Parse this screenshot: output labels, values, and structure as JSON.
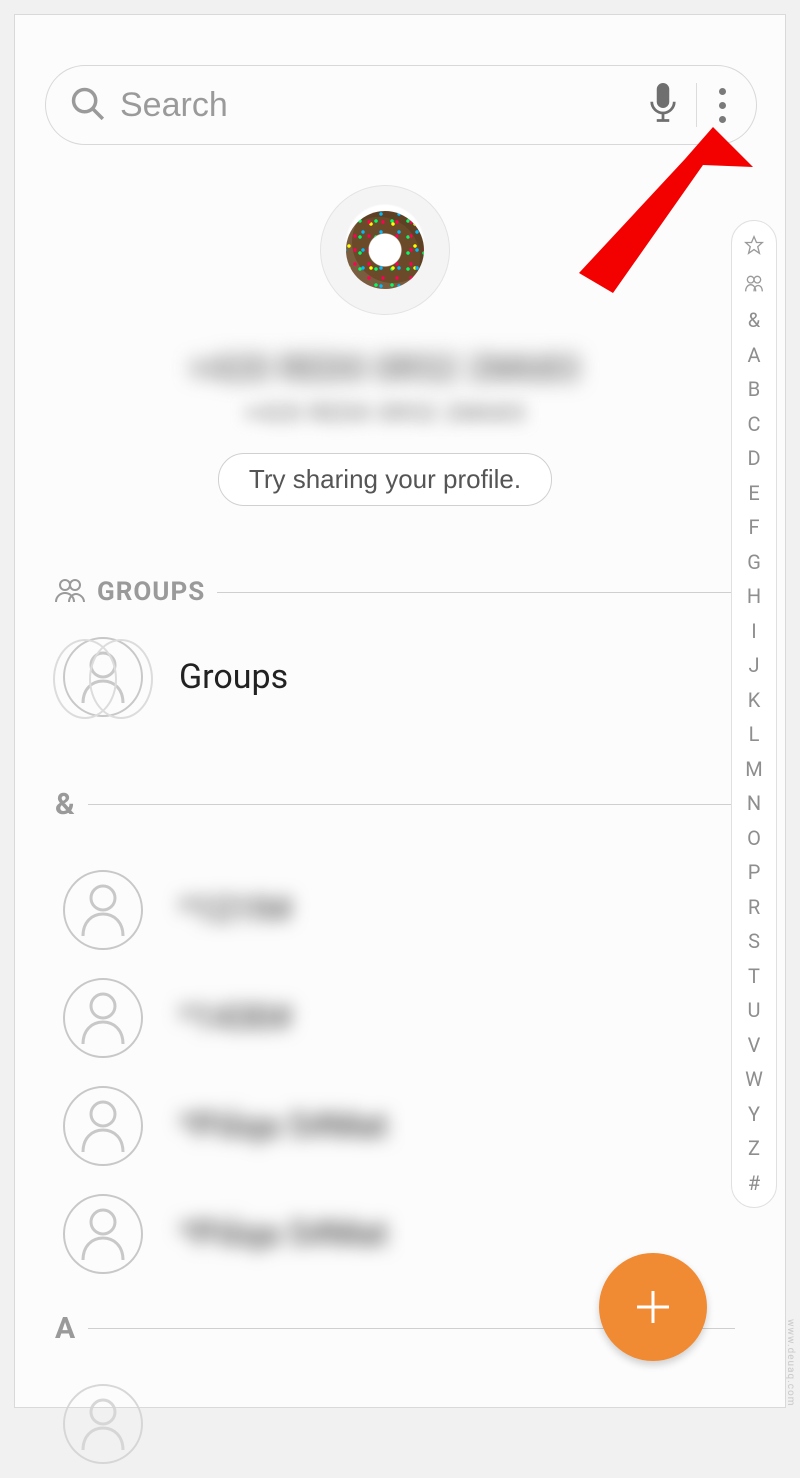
{
  "search": {
    "placeholder": "Search"
  },
  "profile": {
    "name_masked": "+420 RED0 0R52 2M683",
    "sub_masked": "+420 RED0 0R52 2M683",
    "share_button": "Try sharing your profile."
  },
  "sections": {
    "groups": {
      "label": "GROUPS",
      "row_label": "Groups"
    },
    "amp": {
      "label": "&"
    },
    "a": {
      "label": "A"
    }
  },
  "contacts_amp": [
    {
      "name_masked": "*1219#"
    },
    {
      "name_masked": "*1430#"
    },
    {
      "name_masked": "*Pišqa 5#Mat"
    },
    {
      "name_masked": "*Pišqa 5#Mat"
    }
  ],
  "index": [
    "&",
    "A",
    "B",
    "C",
    "D",
    "E",
    "F",
    "G",
    "H",
    "I",
    "J",
    "K",
    "L",
    "M",
    "N",
    "O",
    "P",
    "R",
    "S",
    "T",
    "U",
    "V",
    "W",
    "Y",
    "Z",
    "#"
  ],
  "watermark": "www.deuaq.com"
}
